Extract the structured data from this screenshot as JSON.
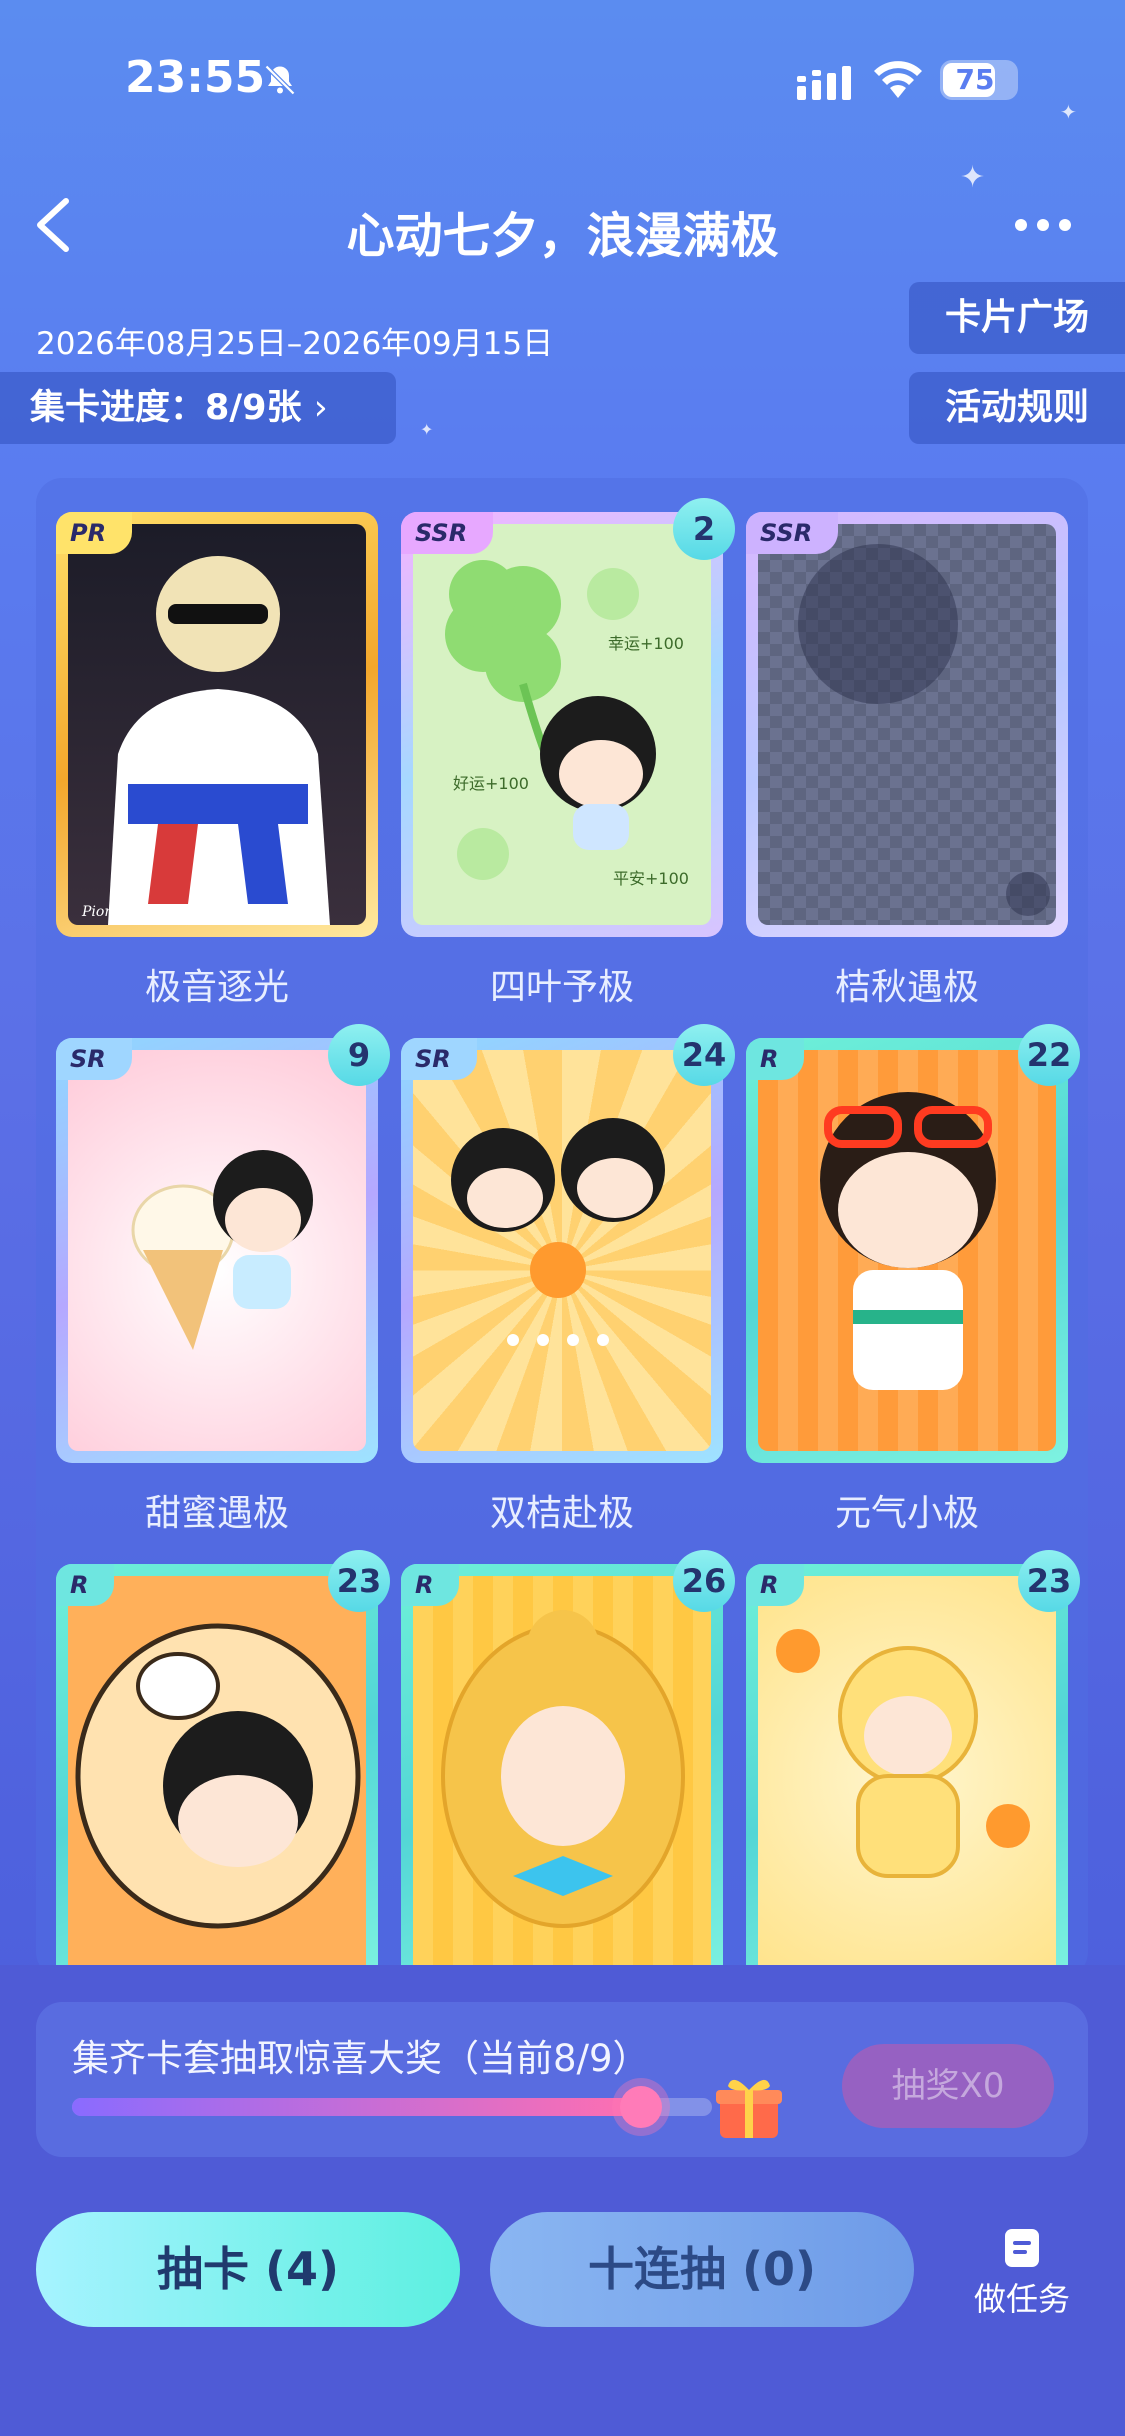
{
  "status_bar": {
    "time": "23:55",
    "battery": "75"
  },
  "header": {
    "title": "心动七夕，浪漫满极",
    "date_range": "2026年08月25日–2026年09月15日",
    "collection_progress": "集卡进度：8/9张",
    "card_plaza": "卡片广场",
    "rules": "活动规则"
  },
  "cards": [
    {
      "name": "极音逐光",
      "rarity": "PR",
      "count": "",
      "watermark": "Pioneer DJ"
    },
    {
      "name": "四叶予极",
      "rarity": "SSR",
      "count": "2",
      "texts": [
        "幸运+100",
        "好运+100",
        "平安+100"
      ]
    },
    {
      "name": "桔秋遇极",
      "rarity": "SSR",
      "count": ""
    },
    {
      "name": "甜蜜遇极",
      "rarity": "SR",
      "count": "9"
    },
    {
      "name": "双桔赴极",
      "rarity": "SR",
      "count": "24"
    },
    {
      "name": "元气小极",
      "rarity": "R",
      "count": "22"
    },
    {
      "name": "",
      "rarity": "R",
      "count": "23"
    },
    {
      "name": "",
      "rarity": "R",
      "count": "26"
    },
    {
      "name": "",
      "rarity": "R",
      "count": "23"
    }
  ],
  "prize": {
    "text": "集齐卡套抽取惊喜大奖（当前8/9）",
    "progress": 0.8889,
    "button": "抽奖X0"
  },
  "actions": {
    "draw_one": "抽卡 (4)",
    "draw_ten": "十连抽 (0)",
    "tasks": "做任务"
  }
}
